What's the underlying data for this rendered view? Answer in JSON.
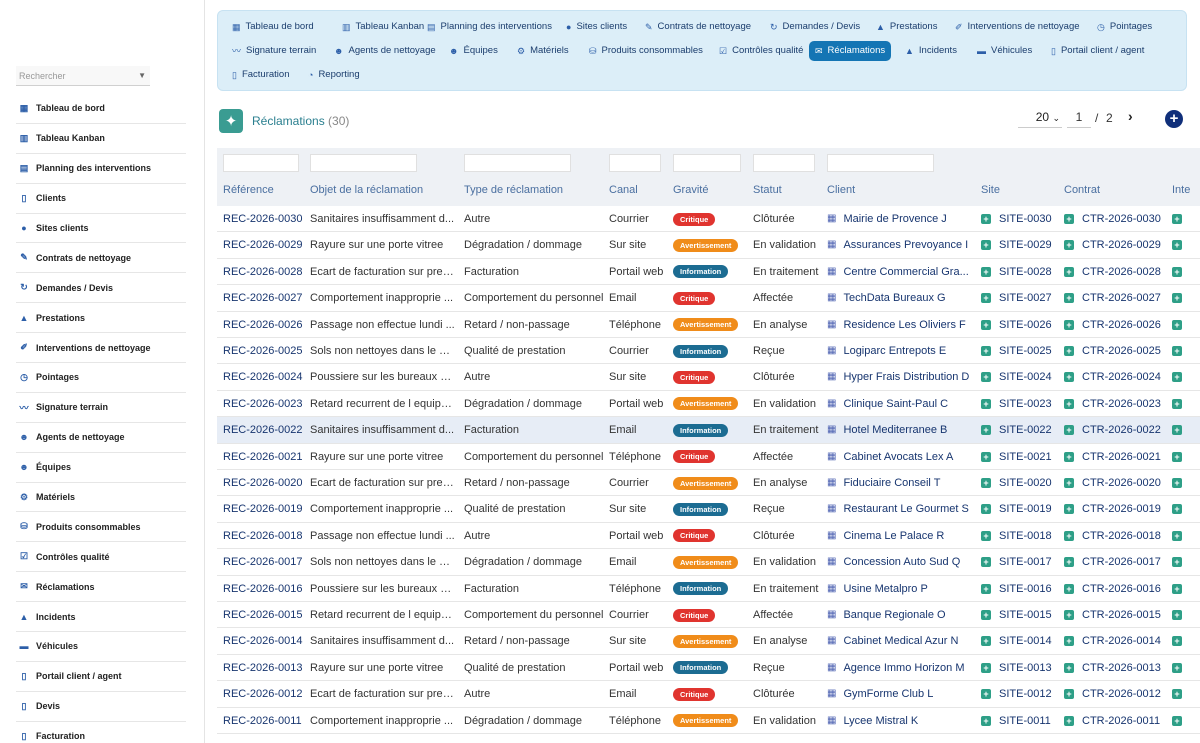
{
  "sidebar": {
    "search_placeholder": "Rechercher",
    "items": [
      {
        "label": "Tableau de bord",
        "icon": "▦"
      },
      {
        "label": "Tableau Kanban",
        "icon": "▥"
      },
      {
        "label": "Planning des interventions",
        "icon": "▤"
      },
      {
        "label": "Clients",
        "icon": "▯"
      },
      {
        "label": "Sites clients",
        "icon": "●"
      },
      {
        "label": "Contrats de nettoyage",
        "icon": "✎"
      },
      {
        "label": "Demandes / Devis",
        "icon": "↻"
      },
      {
        "label": "Prestations",
        "icon": "▲"
      },
      {
        "label": "Interventions de nettoyage",
        "icon": "✐"
      },
      {
        "label": "Pointages",
        "icon": "◷"
      },
      {
        "label": "Signature terrain",
        "icon": "〰"
      },
      {
        "label": "Agents de nettoyage",
        "icon": "☻"
      },
      {
        "label": "Équipes",
        "icon": "☻"
      },
      {
        "label": "Matériels",
        "icon": "⚙"
      },
      {
        "label": "Produits consommables",
        "icon": "⛁"
      },
      {
        "label": "Contrôles qualité",
        "icon": "☑"
      },
      {
        "label": "Réclamations",
        "icon": "✉"
      },
      {
        "label": "Incidents",
        "icon": "▲"
      },
      {
        "label": "Véhicules",
        "icon": "▬"
      },
      {
        "label": "Portail client / agent",
        "icon": "▯"
      },
      {
        "label": "Devis",
        "icon": "▯"
      },
      {
        "label": "Facturation",
        "icon": "▯"
      }
    ]
  },
  "topnav": [
    {
      "label": "Tableau de bord",
      "icon": "▦"
    },
    {
      "label": "Tableau Kanban",
      "icon": "▥"
    },
    {
      "label": "Planning des interventions",
      "icon": "▤"
    },
    {
      "label": "Sites clients",
      "icon": "●"
    },
    {
      "label": "Contrats de nettoyage",
      "icon": "✎"
    },
    {
      "label": "Demandes / Devis",
      "icon": "↻"
    },
    {
      "label": "Prestations",
      "icon": "▲"
    },
    {
      "label": "Interventions de nettoyage",
      "icon": "✐"
    },
    {
      "label": "Pointages",
      "icon": "◷"
    },
    {
      "label": "Signature terrain",
      "icon": "〰"
    },
    {
      "label": "Agents de nettoyage",
      "icon": "☻"
    },
    {
      "label": "Équipes",
      "icon": "☻"
    },
    {
      "label": "Matériels",
      "icon": "⚙"
    },
    {
      "label": "Produits consommables",
      "icon": "⛁"
    },
    {
      "label": "Contrôles qualité",
      "icon": "☑"
    },
    {
      "label": "Réclamations",
      "icon": "✉",
      "active": true
    },
    {
      "label": "Incidents",
      "icon": "▲"
    },
    {
      "label": "Véhicules",
      "icon": "▬"
    },
    {
      "label": "Portail client / agent",
      "icon": "▯"
    },
    {
      "label": "Facturation",
      "icon": "▯"
    },
    {
      "label": "Reporting",
      "icon": "◔"
    }
  ],
  "header": {
    "title": "Réclamations",
    "count": "(30)",
    "page_size": "20",
    "page_current": "1",
    "page_sep": "/",
    "page_total": "2",
    "next_icon": "›",
    "add_icon": "+"
  },
  "table": {
    "columns": [
      "Référence",
      "Objet de la réclamation",
      "Type de réclamation",
      "Canal",
      "Gravité",
      "Statut",
      "Client",
      "Site",
      "Contrat",
      "Inte"
    ],
    "badge_colors": {
      "Critique": "#e0342f",
      "Avertissement": "#f08c1a",
      "Information": "#1c6c92"
    },
    "rows": [
      [
        "REC-2026-0030",
        "Sanitaires insuffisamment d...",
        "Autre",
        "Courrier",
        "Critique",
        "Clôturée",
        "Mairie de Provence J",
        "SITE-0030",
        "CTR-2026-0030"
      ],
      [
        "REC-2026-0029",
        "Rayure sur une porte vitree",
        "Dégradation / dommage",
        "Sur site",
        "Avertissement",
        "En validation",
        "Assurances Prevoyance I",
        "SITE-0029",
        "CTR-2026-0029"
      ],
      [
        "REC-2026-0028",
        "Ecart de facturation sur pres...",
        "Facturation",
        "Portail web",
        "Information",
        "En traitement",
        "Centre Commercial Gra...",
        "SITE-0028",
        "CTR-2026-0028"
      ],
      [
        "REC-2026-0027",
        "Comportement inapproprie ...",
        "Comportement du personnel",
        "Email",
        "Critique",
        "Affectée",
        "TechData Bureaux G",
        "SITE-0027",
        "CTR-2026-0027"
      ],
      [
        "REC-2026-0026",
        "Passage non effectue lundi ...",
        "Retard / non-passage",
        "Téléphone",
        "Avertissement",
        "En analyse",
        "Residence Les Oliviers F",
        "SITE-0026",
        "CTR-2026-0026"
      ],
      [
        "REC-2026-0025",
        "Sols non nettoyes dans le hall",
        "Qualité de prestation",
        "Courrier",
        "Information",
        "Reçue",
        "Logiparc Entrepots E",
        "SITE-0025",
        "CTR-2026-0025"
      ],
      [
        "REC-2026-0024",
        "Poussiere sur les bureaux a...",
        "Autre",
        "Sur site",
        "Critique",
        "Clôturée",
        "Hyper Frais Distribution D",
        "SITE-0024",
        "CTR-2026-0024"
      ],
      [
        "REC-2026-0023",
        "Retard recurrent de l equipe...",
        "Dégradation / dommage",
        "Portail web",
        "Avertissement",
        "En validation",
        "Clinique Saint-Paul C",
        "SITE-0023",
        "CTR-2026-0023"
      ],
      [
        "REC-2026-0022",
        "Sanitaires insuffisamment d...",
        "Facturation",
        "Email",
        "Information",
        "En traitement",
        "Hotel Mediterranee B",
        "SITE-0022",
        "CTR-2026-0022"
      ],
      [
        "REC-2026-0021",
        "Rayure sur une porte vitree",
        "Comportement du personnel",
        "Téléphone",
        "Critique",
        "Affectée",
        "Cabinet Avocats Lex A",
        "SITE-0021",
        "CTR-2026-0021"
      ],
      [
        "REC-2026-0020",
        "Ecart de facturation sur pres...",
        "Retard / non-passage",
        "Courrier",
        "Avertissement",
        "En analyse",
        "Fiduciaire Conseil T",
        "SITE-0020",
        "CTR-2026-0020"
      ],
      [
        "REC-2026-0019",
        "Comportement inapproprie ...",
        "Qualité de prestation",
        "Sur site",
        "Information",
        "Reçue",
        "Restaurant Le Gourmet S",
        "SITE-0019",
        "CTR-2026-0019"
      ],
      [
        "REC-2026-0018",
        "Passage non effectue lundi ...",
        "Autre",
        "Portail web",
        "Critique",
        "Clôturée",
        "Cinema Le Palace R",
        "SITE-0018",
        "CTR-2026-0018"
      ],
      [
        "REC-2026-0017",
        "Sols non nettoyes dans le hall",
        "Dégradation / dommage",
        "Email",
        "Avertissement",
        "En validation",
        "Concession Auto Sud Q",
        "SITE-0017",
        "CTR-2026-0017"
      ],
      [
        "REC-2026-0016",
        "Poussiere sur les bureaux a...",
        "Facturation",
        "Téléphone",
        "Information",
        "En traitement",
        "Usine Metalpro P",
        "SITE-0016",
        "CTR-2026-0016"
      ],
      [
        "REC-2026-0015",
        "Retard recurrent de l equipe...",
        "Comportement du personnel",
        "Courrier",
        "Critique",
        "Affectée",
        "Banque Regionale O",
        "SITE-0015",
        "CTR-2026-0015"
      ],
      [
        "REC-2026-0014",
        "Sanitaires insuffisamment d...",
        "Retard / non-passage",
        "Sur site",
        "Avertissement",
        "En analyse",
        "Cabinet Medical Azur N",
        "SITE-0014",
        "CTR-2026-0014"
      ],
      [
        "REC-2026-0013",
        "Rayure sur une porte vitree",
        "Qualité de prestation",
        "Portail web",
        "Information",
        "Reçue",
        "Agence Immo Horizon M",
        "SITE-0013",
        "CTR-2026-0013"
      ],
      [
        "REC-2026-0012",
        "Ecart de facturation sur pres...",
        "Autre",
        "Email",
        "Critique",
        "Clôturée",
        "GymForme Club L",
        "SITE-0012",
        "CTR-2026-0012"
      ],
      [
        "REC-2026-0011",
        "Comportement inapproprie ...",
        "Dégradation / dommage",
        "Téléphone",
        "Avertissement",
        "En validation",
        "Lycee Mistral K",
        "SITE-0011",
        "CTR-2026-0011"
      ]
    ]
  }
}
